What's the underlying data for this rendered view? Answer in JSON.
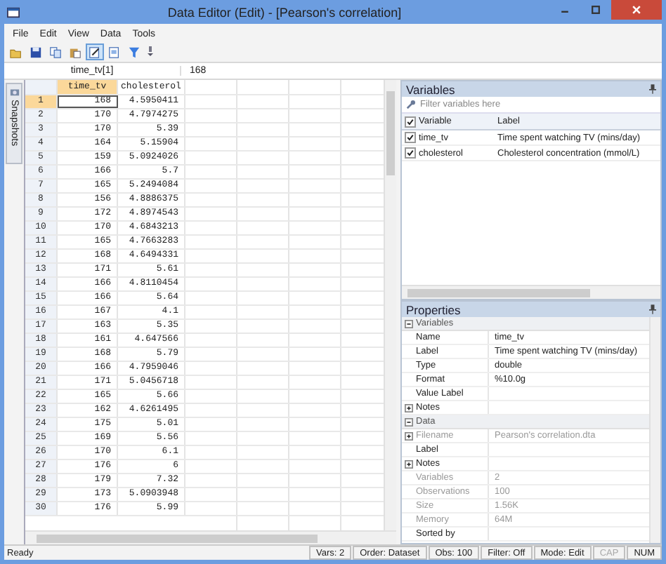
{
  "window": {
    "title": "Data Editor (Edit) - [Pearson's correlation]"
  },
  "menu": [
    "File",
    "Edit",
    "View",
    "Data",
    "Tools"
  ],
  "toolbar": [
    {
      "kind": "open",
      "selected": false
    },
    {
      "kind": "save",
      "selected": false
    },
    {
      "kind": "copy",
      "selected": false
    },
    {
      "kind": "paste",
      "selected": false
    },
    {
      "kind": "edit",
      "selected": true
    },
    {
      "kind": "browse",
      "selected": false
    },
    {
      "kind": "filter",
      "selected": false
    }
  ],
  "cell_bar": {
    "reference": "time_tv[1]",
    "value": "168"
  },
  "side_tab": "Snapshots",
  "grid": {
    "columns": [
      {
        "name": "time_tv",
        "selected": true
      },
      {
        "name": "cholesterol",
        "selected": false
      }
    ],
    "rows": [
      {
        "n": "1",
        "values": [
          "168",
          "4.5950411"
        ],
        "selected": true
      },
      {
        "n": "2",
        "values": [
          "170",
          "4.7974275"
        ],
        "selected": false
      },
      {
        "n": "3",
        "values": [
          "170",
          "5.39"
        ],
        "selected": false
      },
      {
        "n": "4",
        "values": [
          "164",
          "5.15904"
        ],
        "selected": false
      },
      {
        "n": "5",
        "values": [
          "159",
          "5.0924026"
        ],
        "selected": false
      },
      {
        "n": "6",
        "values": [
          "166",
          "5.7"
        ],
        "selected": false
      },
      {
        "n": "7",
        "values": [
          "165",
          "5.2494084"
        ],
        "selected": false
      },
      {
        "n": "8",
        "values": [
          "156",
          "4.8886375"
        ],
        "selected": false
      },
      {
        "n": "9",
        "values": [
          "172",
          "4.8974543"
        ],
        "selected": false
      },
      {
        "n": "10",
        "values": [
          "170",
          "4.6843213"
        ],
        "selected": false
      },
      {
        "n": "11",
        "values": [
          "165",
          "4.7663283"
        ],
        "selected": false
      },
      {
        "n": "12",
        "values": [
          "168",
          "4.6494331"
        ],
        "selected": false
      },
      {
        "n": "13",
        "values": [
          "171",
          "5.61"
        ],
        "selected": false
      },
      {
        "n": "14",
        "values": [
          "166",
          "4.8110454"
        ],
        "selected": false
      },
      {
        "n": "15",
        "values": [
          "166",
          "5.64"
        ],
        "selected": false
      },
      {
        "n": "16",
        "values": [
          "167",
          "4.1"
        ],
        "selected": false
      },
      {
        "n": "17",
        "values": [
          "163",
          "5.35"
        ],
        "selected": false
      },
      {
        "n": "18",
        "values": [
          "161",
          "4.647566"
        ],
        "selected": false
      },
      {
        "n": "19",
        "values": [
          "168",
          "5.79"
        ],
        "selected": false
      },
      {
        "n": "20",
        "values": [
          "166",
          "4.7959046"
        ],
        "selected": false
      },
      {
        "n": "21",
        "values": [
          "171",
          "5.0456718"
        ],
        "selected": false
      },
      {
        "n": "22",
        "values": [
          "165",
          "5.66"
        ],
        "selected": false
      },
      {
        "n": "23",
        "values": [
          "162",
          "4.6261495"
        ],
        "selected": false
      },
      {
        "n": "24",
        "values": [
          "175",
          "5.01"
        ],
        "selected": false
      },
      {
        "n": "25",
        "values": [
          "169",
          "5.56"
        ],
        "selected": false
      },
      {
        "n": "26",
        "values": [
          "170",
          "6.1"
        ],
        "selected": false
      },
      {
        "n": "27",
        "values": [
          "176",
          "6"
        ],
        "selected": false
      },
      {
        "n": "28",
        "values": [
          "179",
          "7.32"
        ],
        "selected": false
      },
      {
        "n": "29",
        "values": [
          "173",
          "5.0903948"
        ],
        "selected": false
      },
      {
        "n": "30",
        "values": [
          "176",
          "5.99"
        ],
        "selected": false
      }
    ]
  },
  "variables_panel": {
    "title": "Variables",
    "filter": {
      "placeholder": "Filter variables here"
    },
    "all_checked": true,
    "columns": [
      "Variable",
      "Label"
    ],
    "rows": [
      {
        "checked": true,
        "name": "time_tv",
        "label": "Time spent watching TV (mins/day)"
      },
      {
        "checked": true,
        "name": "cholesterol",
        "label": "Cholesterol concentration (mmol/L)"
      }
    ]
  },
  "properties_panel": {
    "title": "Properties",
    "groups": [
      {
        "name": "Variables",
        "expanded": true,
        "children": [
          {
            "name": "Name",
            "value": "time_tv",
            "kind": "leaf",
            "disabled": false
          },
          {
            "name": "Label",
            "value": "Time spent watching TV (mins/day)",
            "kind": "leaf",
            "disabled": false
          },
          {
            "name": "Type",
            "value": "double",
            "kind": "leaf",
            "disabled": false
          },
          {
            "name": "Format",
            "value": "%10.0g",
            "kind": "leaf",
            "disabled": false
          },
          {
            "name": "Value Label",
            "kind": "leaf",
            "disabled": false
          },
          {
            "name": "Notes",
            "kind": "node",
            "expanded": false,
            "disabled": false
          }
        ]
      },
      {
        "name": "Data",
        "expanded": true,
        "children": [
          {
            "name": "Filename",
            "value": "Pearson's correlation.dta",
            "kind": "node",
            "expanded": false,
            "disabled": true
          },
          {
            "name": "Label",
            "kind": "leaf",
            "disabled": false
          },
          {
            "name": "Notes",
            "kind": "node",
            "expanded": false,
            "disabled": false
          },
          {
            "name": "Variables",
            "value": "2",
            "kind": "leaf",
            "disabled": true
          },
          {
            "name": "Observations",
            "value": "100",
            "kind": "leaf",
            "disabled": true
          },
          {
            "name": "Size",
            "value": "1.56K",
            "kind": "leaf",
            "disabled": true
          },
          {
            "name": "Memory",
            "value": "64M",
            "kind": "leaf",
            "disabled": true
          },
          {
            "name": "Sorted by",
            "kind": "leaf",
            "disabled": false
          }
        ]
      }
    ]
  },
  "status_bar": [
    {
      "text": "Ready",
      "kind": "message",
      "disabled": false
    },
    {
      "text": "Vars: 2",
      "kind": "pane",
      "disabled": false
    },
    {
      "text": "Order: Dataset",
      "kind": "pane",
      "disabled": false
    },
    {
      "text": "Obs: 100",
      "kind": "pane",
      "disabled": false
    },
    {
      "text": "Filter: Off",
      "kind": "pane",
      "disabled": false
    },
    {
      "text": "Mode: Edit",
      "kind": "pane",
      "disabled": false
    },
    {
      "text": "CAP",
      "kind": "pane",
      "disabled": true
    },
    {
      "text": "NUM",
      "kind": "pane",
      "disabled": false
    }
  ]
}
